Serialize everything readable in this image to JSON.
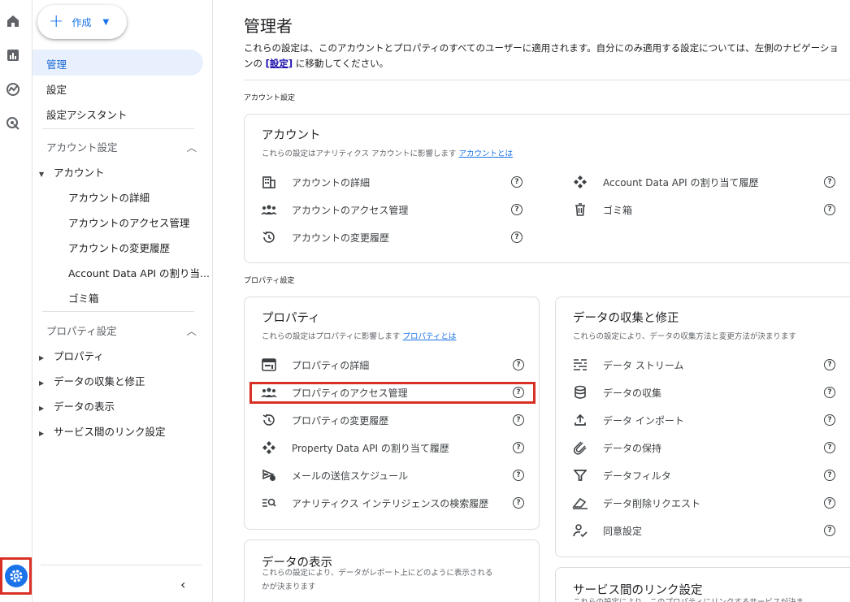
{
  "colors": {
    "accent": "#1a73e8",
    "highlight": "#d93025",
    "active_bg": "#e8f0fe"
  },
  "rail": {
    "icons": [
      "home-icon",
      "reports-icon",
      "explore-icon",
      "advertising-icon",
      "settings-icon"
    ]
  },
  "sidebar": {
    "create_label": "作成",
    "top_items": [
      "管理",
      "設定",
      "設定アシスタント"
    ],
    "account_group": {
      "label": "アカウント設定",
      "parent": "アカウント",
      "children": [
        "アカウントの詳細",
        "アカウントのアクセス管理",
        "アカウントの変更履歴",
        "Account Data API の割り当...",
        "ゴミ箱"
      ]
    },
    "property_group": {
      "label": "プロパティ設定",
      "children": [
        "プロパティ",
        "データの収集と修正",
        "データの表示",
        "サービス間のリンク設定"
      ]
    }
  },
  "main": {
    "title": "管理者",
    "desc_part1": "これらの設定は、このアカウントとプロパティのすべてのユーザーに適用されます。自分にのみ適用する設定については、左側のナビゲーションの ",
    "desc_link": "[設定]",
    "desc_part2": " に移動してください。",
    "account_section_label": "アカウント設定",
    "property_section_label": "プロパティ設定",
    "account_card": {
      "title": "アカウント",
      "sub": "これらの設定はアナリティクス アカウントに影響します ",
      "sub_link": "アカウントとは",
      "left_rows": [
        "アカウントの詳細",
        "アカウントのアクセス管理",
        "アカウントの変更履歴"
      ],
      "right_rows": [
        "Account Data API の割り当て履歴",
        "ゴミ箱"
      ]
    },
    "property_card": {
      "title": "プロパティ",
      "sub": "これらの設定はプロパティに影響します ",
      "sub_link": "プロパティとは",
      "rows": [
        "プロパティの詳細",
        "プロパティのアクセス管理",
        "プロパティの変更履歴",
        "Property Data API の割り当て履歴",
        "メールの送信スケジュール",
        "アナリティクス インテリジェンスの検索履歴"
      ]
    },
    "data_collection_card": {
      "title": "データの収集と修正",
      "sub": "これらの設定により、データの収集方法と変更方法が決まります",
      "rows": [
        "データ ストリーム",
        "データの収集",
        "データ インポート",
        "データの保持",
        "データフィルタ",
        "データ削除リクエスト",
        "同意設定"
      ]
    },
    "data_display_card": {
      "title": "データの表示",
      "sub": "これらの設定により、データがレポート上にどのように表示される",
      "sub2": "かが決まります"
    },
    "link_card": {
      "title": "サービス間のリンク設定",
      "sub": "これらの設定により、このプロパティにリンクするサービスが決ま"
    }
  }
}
